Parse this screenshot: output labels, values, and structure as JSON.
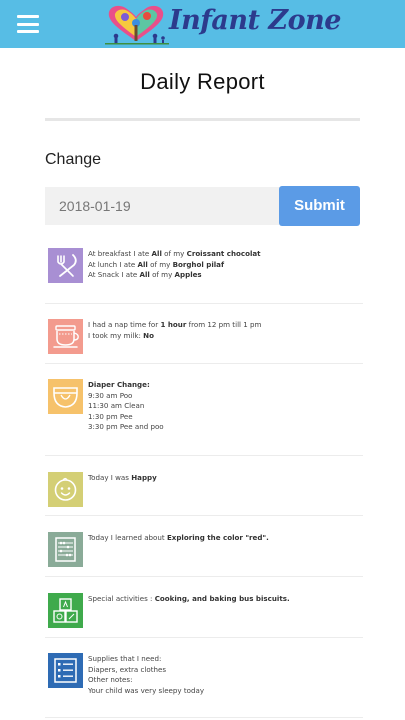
{
  "app": {
    "title": "Infant Zone",
    "menu_icon": "hamburger-icon",
    "logo_icon": "heart-tree-family-logo"
  },
  "colors": {
    "header_bg": "#57bde5",
    "title_color": "#2c3a8c",
    "submit_bg": "#5b9be6",
    "meal_icon_bg": "#a88fd3",
    "nap_icon_bg": "#f39b8e",
    "diaper_icon_bg": "#f6c26b",
    "mood_icon_bg": "#d4cf75",
    "learned_icon_bg": "#8aab98",
    "activities_icon_bg": "#3faa4c",
    "supplies_icon_bg": "#2e6bb4"
  },
  "page": {
    "title": "Daily Report",
    "change_label": "Change",
    "date_value": "2018-01-19",
    "submit_label": "Submit"
  },
  "report": {
    "meals": {
      "icon": "fork-knife-icon",
      "lines": [
        [
          "At breakfast I ate ",
          "All",
          " of my ",
          "Croissant chocolat"
        ],
        [
          "At lunch I ate ",
          "All",
          " of my ",
          "Borghol pilaf"
        ],
        [
          "At Snack I ate ",
          "All",
          " of my ",
          "Apples"
        ]
      ]
    },
    "nap": {
      "icon": "cup-icon",
      "line1": [
        "I had a nap time for ",
        "1 hour",
        " from 12 pm till 1 pm"
      ],
      "line2": [
        "I took my milk: ",
        "No"
      ]
    },
    "diaper": {
      "icon": "diaper-icon",
      "heading": "Diaper Change:",
      "lines": [
        "9:30 am Poo",
        "11:30 am Clean",
        "1:30 pm Pee",
        "3:30 pm Pee and poo"
      ]
    },
    "mood": {
      "icon": "baby-face-icon",
      "line": [
        "Today I was ",
        "Happy"
      ]
    },
    "learned": {
      "icon": "abacus-icon",
      "line": [
        "Today I learned about ",
        "Exploring the color \"red\"."
      ]
    },
    "activities": {
      "icon": "blocks-icon",
      "line": [
        "Special activities : ",
        "Cooking, and baking bus biscuits."
      ]
    },
    "supplies": {
      "icon": "checklist-icon",
      "lines": [
        "Supplies that I need:",
        "Diapers, extra clothes",
        "Other notes:",
        "Your child was very sleepy today"
      ]
    }
  }
}
